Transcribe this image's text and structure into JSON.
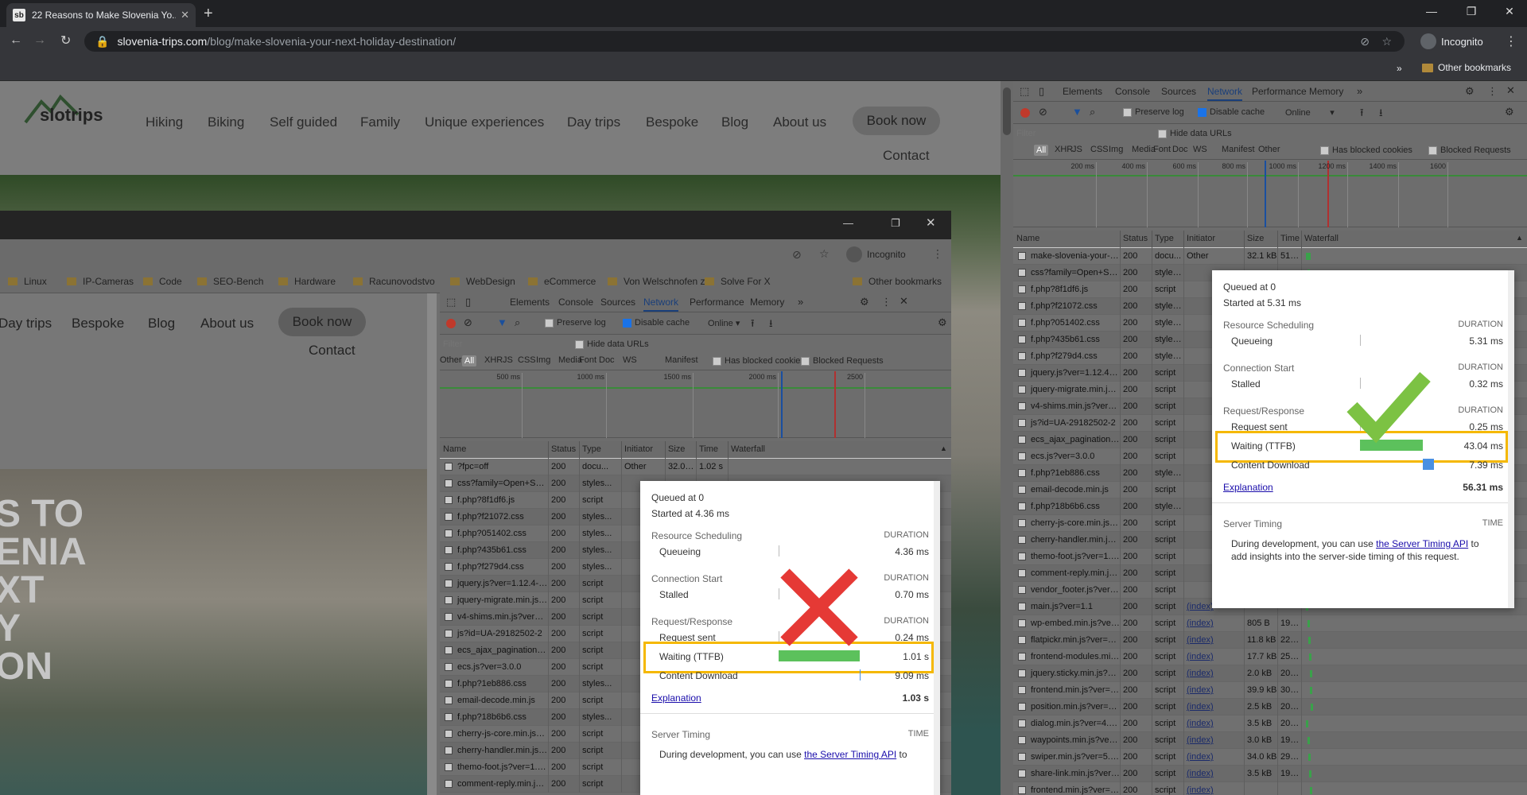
{
  "browser": {
    "tab_title": "22 Reasons to Make Slovenia Yo...",
    "tab_favicon": "sb",
    "url_host": "slovenia-trips.com",
    "url_path": "/blog/make-slovenia-your-next-holiday-destination/",
    "incognito": "Incognito",
    "other_bookmarks": "Other bookmarks"
  },
  "site": {
    "logo": "slotrips",
    "nav": [
      "Hiking",
      "Biking",
      "Self guided",
      "Family",
      "Unique experiences",
      "Day trips",
      "Bespoke",
      "Blog",
      "About us"
    ],
    "book_now": "Book now",
    "contact": "Contact"
  },
  "inner_browser": {
    "incognito": "Incognito",
    "bookmarks": [
      "Linux",
      "IP-Cameras",
      "Code",
      "SEO-Bench",
      "Hardware",
      "Racunovodstvo",
      "WebDesign",
      "eCommerce",
      "Von Welschnofen z...",
      "Solve For X"
    ],
    "other_bookmarks": "Other bookmarks",
    "nav": [
      "Day trips",
      "Bespoke",
      "Blog",
      "About us"
    ],
    "book_now": "Book now",
    "contact": "Contact",
    "hero_lines": [
      "S TO",
      "ENIA",
      "XT",
      "Y",
      "ON"
    ]
  },
  "devtools": {
    "tabs": [
      "Elements",
      "Console",
      "Sources",
      "Network",
      "Performance",
      "Memory"
    ],
    "preserve_log": "Preserve log",
    "disable_cache": "Disable cache",
    "online": "Online",
    "filter_placeholder": "Filter",
    "hide_data_urls": "Hide data URLs",
    "types": [
      "All",
      "XHR",
      "JS",
      "CSS",
      "Img",
      "Media",
      "Font",
      "Doc",
      "WS",
      "Manifest",
      "Other"
    ],
    "has_blocked_cookies": "Has blocked cookies",
    "blocked_requests": "Blocked Requests",
    "columns": [
      "Name",
      "Status",
      "Type",
      "Initiator",
      "Size",
      "Time",
      "Waterfall"
    ]
  },
  "left_devtools": {
    "ticks": [
      "500 ms",
      "1000 ms",
      "1500 ms",
      "2000 ms",
      "2500"
    ],
    "rows": [
      {
        "name": "?fpc=off",
        "status": "200",
        "type": "docu...",
        "initiator": "Other",
        "size": "32.0 kB",
        "time": "1.02 s"
      },
      {
        "name": "css?family=Open+Sans...",
        "status": "200",
        "type": "styles...",
        "initiator": "",
        "size": "",
        "time": ""
      },
      {
        "name": "f.php?8f1df6.js",
        "status": "200",
        "type": "script",
        "initiator": "",
        "size": "",
        "time": ""
      },
      {
        "name": "f.php?f21072.css",
        "status": "200",
        "type": "styles...",
        "initiator": "",
        "size": "",
        "time": ""
      },
      {
        "name": "f.php?051402.css",
        "status": "200",
        "type": "styles...",
        "initiator": "",
        "size": "",
        "time": ""
      },
      {
        "name": "f.php?435b61.css",
        "status": "200",
        "type": "styles...",
        "initiator": "",
        "size": "",
        "time": ""
      },
      {
        "name": "f.php?f279d4.css",
        "status": "200",
        "type": "styles...",
        "initiator": "",
        "size": "",
        "time": ""
      },
      {
        "name": "jquery.js?ver=1.12.4-wp",
        "status": "200",
        "type": "script",
        "initiator": "",
        "size": "",
        "time": ""
      },
      {
        "name": "jquery-migrate.min.js?...",
        "status": "200",
        "type": "script",
        "initiator": "",
        "size": "",
        "time": ""
      },
      {
        "name": "v4-shims.min.js?ver=3.0...",
        "status": "200",
        "type": "script",
        "initiator": "",
        "size": "",
        "time": ""
      },
      {
        "name": "js?id=UA-29182502-2",
        "status": "200",
        "type": "script",
        "initiator": "",
        "size": "",
        "time": ""
      },
      {
        "name": "ecs_ajax_pagination.js?v...",
        "status": "200",
        "type": "script",
        "initiator": "",
        "size": "",
        "time": ""
      },
      {
        "name": "ecs.js?ver=3.0.0",
        "status": "200",
        "type": "script",
        "initiator": "",
        "size": "",
        "time": ""
      },
      {
        "name": "f.php?1eb886.css",
        "status": "200",
        "type": "styles...",
        "initiator": "",
        "size": "",
        "time": ""
      },
      {
        "name": "email-decode.min.js",
        "status": "200",
        "type": "script",
        "initiator": "",
        "size": "",
        "time": ""
      },
      {
        "name": "f.php?18b6b6.css",
        "status": "200",
        "type": "styles...",
        "initiator": "",
        "size": "",
        "time": ""
      },
      {
        "name": "cherry-js-core.min.js?ver...",
        "status": "200",
        "type": "script",
        "initiator": "",
        "size": "",
        "time": ""
      },
      {
        "name": "cherry-handler.min.js?v...",
        "status": "200",
        "type": "script",
        "initiator": "",
        "size": "",
        "time": ""
      },
      {
        "name": "themo-foot.js?ver=1.5.13",
        "status": "200",
        "type": "script",
        "initiator": "",
        "size": "",
        "time": ""
      },
      {
        "name": "comment-reply.min.js?v...",
        "status": "200",
        "type": "script",
        "initiator": "",
        "size": "",
        "time": ""
      }
    ],
    "popup": {
      "queued": "Queued at 0",
      "started": "Started at 4.36 ms",
      "sections": [
        {
          "title": "Resource Scheduling",
          "dur": "DURATION",
          "items": [
            {
              "label": "Queueing",
              "value": "4.36 ms"
            }
          ]
        },
        {
          "title": "Connection Start",
          "dur": "DURATION",
          "items": [
            {
              "label": "Stalled",
              "value": "0.70 ms"
            }
          ]
        },
        {
          "title": "Request/Response",
          "dur": "DURATION",
          "items": [
            {
              "label": "Request sent",
              "value": "0.24 ms"
            },
            {
              "label": "Waiting (TTFB)",
              "value": "1.01 s"
            },
            {
              "label": "Content Download",
              "value": "9.09 ms"
            }
          ]
        }
      ],
      "explanation": "Explanation",
      "total": "1.03 s",
      "server_timing": "Server Timing",
      "time": "TIME",
      "dev_note_a": "During development, you can use ",
      "dev_note_link": "the Server Timing API",
      "dev_note_b": " to",
      "ttfb_ratio": 0.98,
      "verdict_color": "#e53935"
    }
  },
  "right_devtools": {
    "ticks": [
      "200 ms",
      "400 ms",
      "600 ms",
      "800 ms",
      "1000 ms",
      "1200 ms",
      "1400 ms",
      "1600"
    ],
    "rows": [
      {
        "name": "make-slovenia-your-ne...",
        "status": "200",
        "type": "docu...",
        "initiator": "Other",
        "size": "32.1 kB",
        "time": "51 ms"
      },
      {
        "name": "css?family=Open+Sans...",
        "status": "200",
        "type": "styles...",
        "initiator": "",
        "size": "",
        "time": ""
      },
      {
        "name": "f.php?8f1df6.js",
        "status": "200",
        "type": "script",
        "initiator": "",
        "size": "",
        "time": ""
      },
      {
        "name": "f.php?f21072.css",
        "status": "200",
        "type": "styles...",
        "initiator": "",
        "size": "",
        "time": ""
      },
      {
        "name": "f.php?051402.css",
        "status": "200",
        "type": "styles...",
        "initiator": "",
        "size": "",
        "time": ""
      },
      {
        "name": "f.php?435b61.css",
        "status": "200",
        "type": "styles...",
        "initiator": "",
        "size": "",
        "time": ""
      },
      {
        "name": "f.php?f279d4.css",
        "status": "200",
        "type": "styles...",
        "initiator": "",
        "size": "",
        "time": ""
      },
      {
        "name": "jquery.js?ver=1.12.4-wp",
        "status": "200",
        "type": "script",
        "initiator": "",
        "size": "",
        "time": ""
      },
      {
        "name": "jquery-migrate.min.js?...",
        "status": "200",
        "type": "script",
        "initiator": "",
        "size": "",
        "time": ""
      },
      {
        "name": "v4-shims.min.js?ver=3.0...",
        "status": "200",
        "type": "script",
        "initiator": "",
        "size": "",
        "time": ""
      },
      {
        "name": "js?id=UA-29182502-2",
        "status": "200",
        "type": "script",
        "initiator": "",
        "size": "",
        "time": ""
      },
      {
        "name": "ecs_ajax_pagination.js?v...",
        "status": "200",
        "type": "script",
        "initiator": "",
        "size": "",
        "time": ""
      },
      {
        "name": "ecs.js?ver=3.0.0",
        "status": "200",
        "type": "script",
        "initiator": "",
        "size": "",
        "time": ""
      },
      {
        "name": "f.php?1eb886.css",
        "status": "200",
        "type": "styles...",
        "initiator": "",
        "size": "",
        "time": ""
      },
      {
        "name": "email-decode.min.js",
        "status": "200",
        "type": "script",
        "initiator": "",
        "size": "",
        "time": ""
      },
      {
        "name": "f.php?18b6b6.css",
        "status": "200",
        "type": "styles...",
        "initiator": "",
        "size": "",
        "time": ""
      },
      {
        "name": "cherry-js-core.min.js?ver...",
        "status": "200",
        "type": "script",
        "initiator": "",
        "size": "",
        "time": ""
      },
      {
        "name": "cherry-handler.min.js?v...",
        "status": "200",
        "type": "script",
        "initiator": "",
        "size": "",
        "time": ""
      },
      {
        "name": "themo-foot.js?ver=1.5.13",
        "status": "200",
        "type": "script",
        "initiator": "",
        "size": "",
        "time": ""
      },
      {
        "name": "comment-reply.min.js?v...",
        "status": "200",
        "type": "script",
        "initiator": "",
        "size": "",
        "time": ""
      },
      {
        "name": "vendor_footer.js?ver=1.2",
        "status": "200",
        "type": "script",
        "initiator": "",
        "size": "",
        "time": ""
      },
      {
        "name": "main.js?ver=1.1",
        "status": "200",
        "type": "script",
        "initiator": "(index)",
        "size": "",
        "time": ""
      },
      {
        "name": "wp-embed.min.js?ver=5...",
        "status": "200",
        "type": "script",
        "initiator": "(index)",
        "size": "805 B",
        "time": "19 ms"
      },
      {
        "name": "flatpickr.min.js?ver=4.1.4",
        "status": "200",
        "type": "script",
        "initiator": "(index)",
        "size": "11.8 kB",
        "time": "22 ms"
      },
      {
        "name": "frontend-modules.min.js...",
        "status": "200",
        "type": "script",
        "initiator": "(index)",
        "size": "17.7 kB",
        "time": "25 ms"
      },
      {
        "name": "jquery.sticky.min.js?ver=...",
        "status": "200",
        "type": "script",
        "initiator": "(index)",
        "size": "2.0 kB",
        "time": "20 ms"
      },
      {
        "name": "frontend.min.js?ver=3.0.5",
        "status": "200",
        "type": "script",
        "initiator": "(index)",
        "size": "39.9 kB",
        "time": "30 ms"
      },
      {
        "name": "position.min.js?ver=1.11.4",
        "status": "200",
        "type": "script",
        "initiator": "(index)",
        "size": "2.5 kB",
        "time": "20 ms"
      },
      {
        "name": "dialog.min.js?ver=4.8.1",
        "status": "200",
        "type": "script",
        "initiator": "(index)",
        "size": "3.5 kB",
        "time": "20 ms"
      },
      {
        "name": "waypoints.min.js?ver=4...",
        "status": "200",
        "type": "script",
        "initiator": "(index)",
        "size": "3.0 kB",
        "time": "19 ms"
      },
      {
        "name": "swiper.min.js?ver=5.3.6",
        "status": "200",
        "type": "script",
        "initiator": "(index)",
        "size": "34.0 kB",
        "time": "29 ms"
      },
      {
        "name": "share-link.min.js?ver=3....",
        "status": "200",
        "type": "script",
        "initiator": "(index)",
        "size": "3.5 kB",
        "time": "19 ms"
      },
      {
        "name": "frontend.min.js?ver=3.0...",
        "status": "200",
        "type": "script",
        "initiator": "(index)",
        "size": "",
        "time": ""
      }
    ],
    "popup": {
      "queued": "Queued at 0",
      "started": "Started at 5.31 ms",
      "sections": [
        {
          "title": "Resource Scheduling",
          "dur": "DURATION",
          "items": [
            {
              "label": "Queueing",
              "value": "5.31 ms"
            }
          ]
        },
        {
          "title": "Connection Start",
          "dur": "DURATION",
          "items": [
            {
              "label": "Stalled",
              "value": "0.32 ms"
            }
          ]
        },
        {
          "title": "Request/Response",
          "dur": "DURATION",
          "items": [
            {
              "label": "Request sent",
              "value": "0.25 ms"
            },
            {
              "label": "Waiting (TTFB)",
              "value": "43.04 ms"
            },
            {
              "label": "Content Download",
              "value": "7.39 ms"
            }
          ]
        }
      ],
      "explanation": "Explanation",
      "total": "56.31 ms",
      "server_timing": "Server Timing",
      "time": "TIME",
      "dev_note_a": "During development, you can use ",
      "dev_note_link": "the Server Timing API",
      "dev_note_b": " to",
      "dev_note_c": "add insights into the server-side timing of this request.",
      "ttfb_ratio": 0.76,
      "verdict_color": "#7cc243"
    }
  },
  "colors": {
    "accent": "#1a73e8",
    "highlight": "#f5b800",
    "ttfb_bar": "#5cc15c",
    "cross": "#e53935",
    "check": "#7cc243"
  }
}
